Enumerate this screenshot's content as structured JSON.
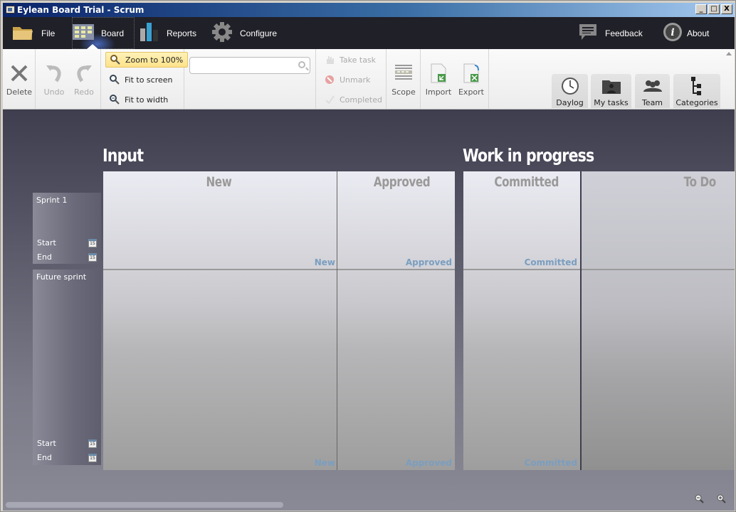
{
  "window": {
    "title": "Eylean Board Trial - Scrum",
    "controls": {
      "minimize": "_",
      "maximize": "□",
      "close": "X"
    }
  },
  "menubar": {
    "items": [
      {
        "label": "File",
        "icon": "folder-icon"
      },
      {
        "label": "Board",
        "icon": "board-icon",
        "active": true
      },
      {
        "label": "Reports",
        "icon": "bar-chart-icon"
      },
      {
        "label": "Configure",
        "icon": "gear-icon"
      }
    ],
    "right": [
      {
        "label": "Feedback",
        "icon": "speech-bubble-icon"
      },
      {
        "label": "About",
        "icon": "info-icon"
      }
    ]
  },
  "ribbon": {
    "delete": {
      "label": "Delete",
      "enabled": true
    },
    "undo": {
      "label": "Undo",
      "enabled": false
    },
    "redo": {
      "label": "Redo",
      "enabled": false
    },
    "zoom_100": {
      "label": "Zoom to 100%",
      "highlighted": true
    },
    "fit_screen": {
      "label": "Fit to screen"
    },
    "fit_width": {
      "label": "Fit to width"
    },
    "search": {
      "value": "",
      "placeholder": ""
    },
    "take_task": {
      "label": "Take task",
      "enabled": false
    },
    "unmark": {
      "label": "Unmark",
      "enabled": false
    },
    "completed": {
      "label": "Completed",
      "enabled": false
    },
    "scope": {
      "label": "Scope"
    },
    "import": {
      "label": "Import"
    },
    "export": {
      "label": "Export"
    },
    "panels": [
      {
        "label": "Daylog",
        "icon": "clock-icon"
      },
      {
        "label": "My tasks",
        "icon": "user-folder-icon"
      },
      {
        "label": "Team",
        "icon": "team-icon"
      },
      {
        "label": "Categories",
        "icon": "hierarchy-icon"
      }
    ]
  },
  "board": {
    "sections": [
      {
        "title": "Input"
      },
      {
        "title": "Work in progress"
      }
    ],
    "columns": [
      {
        "header": "New",
        "label": "New"
      },
      {
        "header": "Approved",
        "label": "Approved"
      },
      {
        "header": "Committed",
        "label": "Committed"
      },
      {
        "header": "To Do",
        "label": ""
      }
    ],
    "sprints": [
      {
        "name": "Sprint 1",
        "start_label": "Start",
        "end_label": "End",
        "cal_day": "15"
      },
      {
        "name": "Future sprint",
        "start_label": "Start",
        "end_label": "End",
        "cal_day": "15"
      }
    ]
  }
}
